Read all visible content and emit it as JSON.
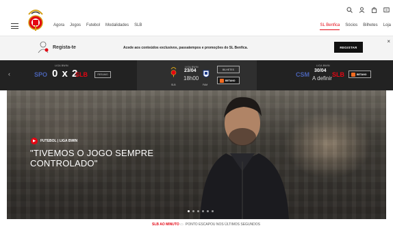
{
  "header": {
    "nav": [
      "Agora",
      "Jogos",
      "Futebol",
      "Modalidades",
      "SLB"
    ],
    "right_nav": [
      "SL Benfica",
      "Sócios",
      "Bilhetes",
      "Loja"
    ]
  },
  "register_bar": {
    "label": "Regista-te",
    "text": "Acede aos conteúdos exclusivos, passatempos e promoções do SL Benfica.",
    "button": "REGISTAR",
    "close": "×"
  },
  "matches": {
    "m1": {
      "league": "LIGA BWIN",
      "home": "SPO",
      "score": "0 x 2",
      "away": "SLB",
      "button": "RESUMO"
    },
    "m2": {
      "league": "LIGA BWIN",
      "date": "23/04",
      "time": "18h00",
      "home": "SLB",
      "away": "FAM",
      "button": "BILHETES",
      "sponsor": "BETANO"
    },
    "m3": {
      "league": "LIGA BWIN",
      "home": "CSM",
      "date": "30/04",
      "time": "A definir",
      "away": "SLB",
      "sponsor": "BETANO"
    }
  },
  "hero": {
    "tag": "FUTEBOL | LIGA BWIN",
    "headline": "\"TIVEMOS O JOGO SEMPRE CONTROLADO\"",
    "dots": 6,
    "active_dot": 0
  },
  "ticker": {
    "label": "SLB AO MINUTO",
    "text": "PONTO ESCAPOU NOS ÚLTIMOS SEGUNDOS"
  },
  "colors": {
    "accent": "#e30613",
    "dark": "#222222"
  }
}
